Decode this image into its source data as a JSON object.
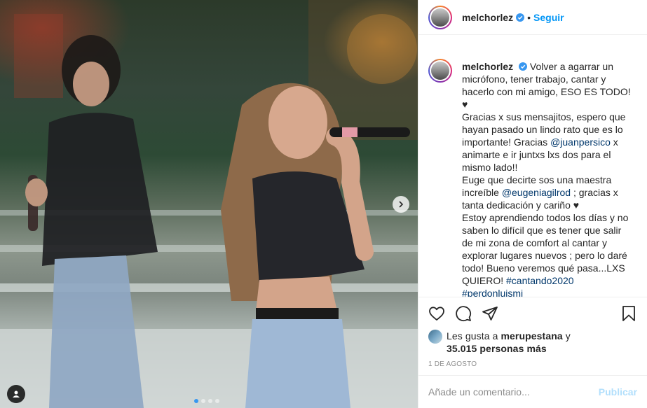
{
  "post": {
    "username": "melchorlez",
    "follow_label": "Seguir",
    "separator": "•",
    "caption_username": "melchorlez",
    "caption": [
      {
        "text": "Volver a agarrar un micrófono, tener trabajo, cantar y hacerlo con mi amigo, ESO ES TODO! ♥"
      },
      {
        "text": "Gracias x sus mensajitos, espero que hayan pasado un lindo rato que es lo importante! Gracias "
      },
      {
        "mention": "@juanpersico"
      },
      {
        "text": " x animarte e ir juntxs lxs dos para el mismo lado!!"
      },
      {
        "text": "Euge que decirte sos una maestra increíble "
      },
      {
        "mention": "@eugeniagilrod"
      },
      {
        "text": " ; gracias x tanta dedicación y cariño ♥"
      },
      {
        "text": "Estoy aprendiendo todos los días y no saben lo difícil que es tener que salir de mi zona de comfort al cantar y explorar lugares nuevos ; pero lo daré todo! Bueno veremos qué pasa...LXS QUIERO! "
      },
      {
        "hashtag": "#cantando2020"
      },
      {
        "hashtag": "#perdonluismi"
      }
    ],
    "likes": {
      "prefix": "Les gusta a",
      "user": "merupestana",
      "connector": "y",
      "others": "35.015 personas más"
    },
    "date": "1 DE AGOSTO",
    "comment_placeholder": "Añade un comentario...",
    "publish_label": "Publicar",
    "carousel": {
      "count": 4,
      "active_index": 0
    }
  },
  "icons": {
    "verified": "verified-badge-icon",
    "next": "chevron-right-icon",
    "tag": "user-tag-icon",
    "like": "heart-icon",
    "comment": "comment-bubble-icon",
    "share": "paper-plane-icon",
    "save": "bookmark-icon"
  },
  "colors": {
    "accent": "#0095f6",
    "link": "#00376b",
    "muted": "#8e8e8e",
    "carousel_active": "#3897f0"
  }
}
